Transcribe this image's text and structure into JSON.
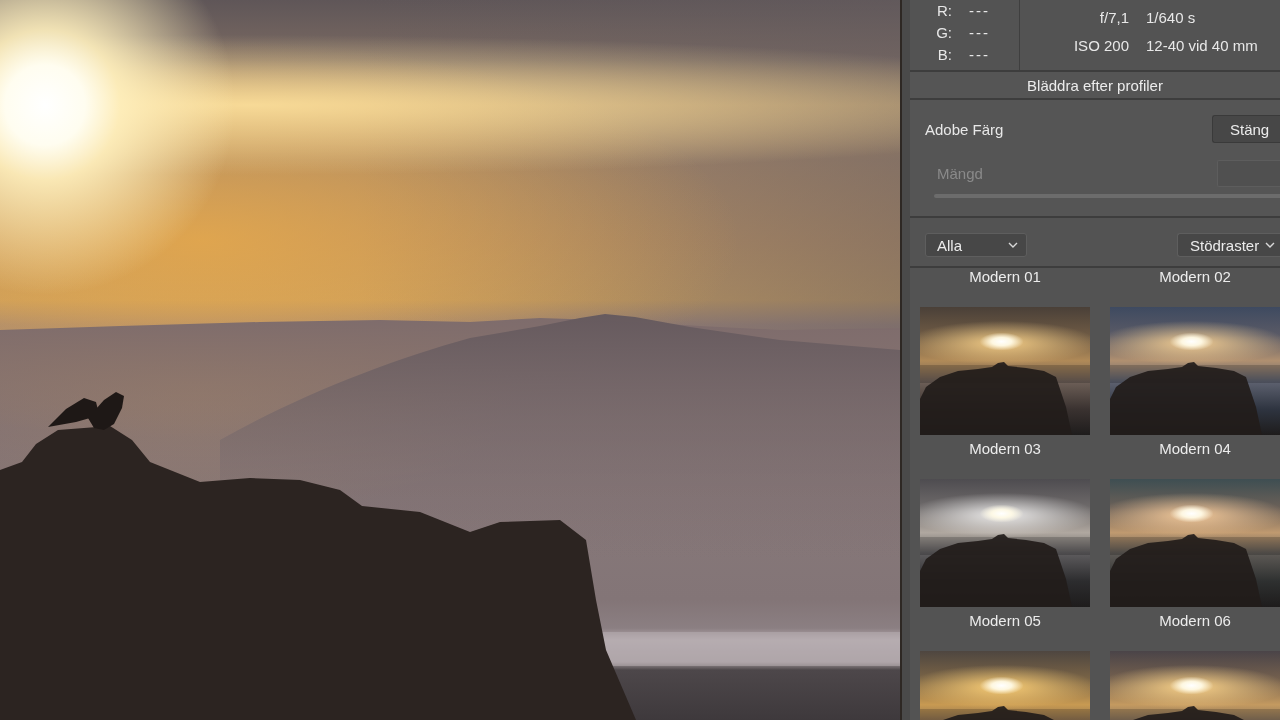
{
  "readout": {
    "rgb": [
      {
        "channel": "R:",
        "reading": "---"
      },
      {
        "channel": "G:",
        "reading": "---"
      },
      {
        "channel": "B:",
        "reading": "---"
      }
    ],
    "camera": [
      {
        "left": "f/7,1",
        "right": "1/640 s"
      },
      {
        "left": "ISO 200",
        "right": "12-40 vid 40 mm"
      }
    ]
  },
  "browse_button": {
    "label": "Bläddra efter profiler"
  },
  "profile": {
    "name": "Adobe Färg",
    "close_button": "Stäng",
    "amount": {
      "label": "Mängd",
      "disabled": true
    }
  },
  "dropdowns": [
    {
      "value": "Alla"
    },
    {
      "value": "Stödraster"
    }
  ],
  "presets": [
    {
      "label": "Modern 01",
      "thumbnail": false,
      "selected": false
    },
    {
      "label": "Modern 02",
      "thumbnail": false,
      "selected": false
    },
    {
      "label": "Modern 03",
      "thumbnail": true,
      "selected": false
    },
    {
      "label": "Modern 04",
      "thumbnail": true,
      "selected": false
    },
    {
      "label": "Modern 05",
      "thumbnail": true,
      "selected": false
    },
    {
      "label": "Modern 06",
      "thumbnail": true,
      "selected": false
    },
    {
      "thumbnail": true,
      "selected": false
    },
    {
      "thumbnail": true,
      "selected": false
    }
  ]
}
